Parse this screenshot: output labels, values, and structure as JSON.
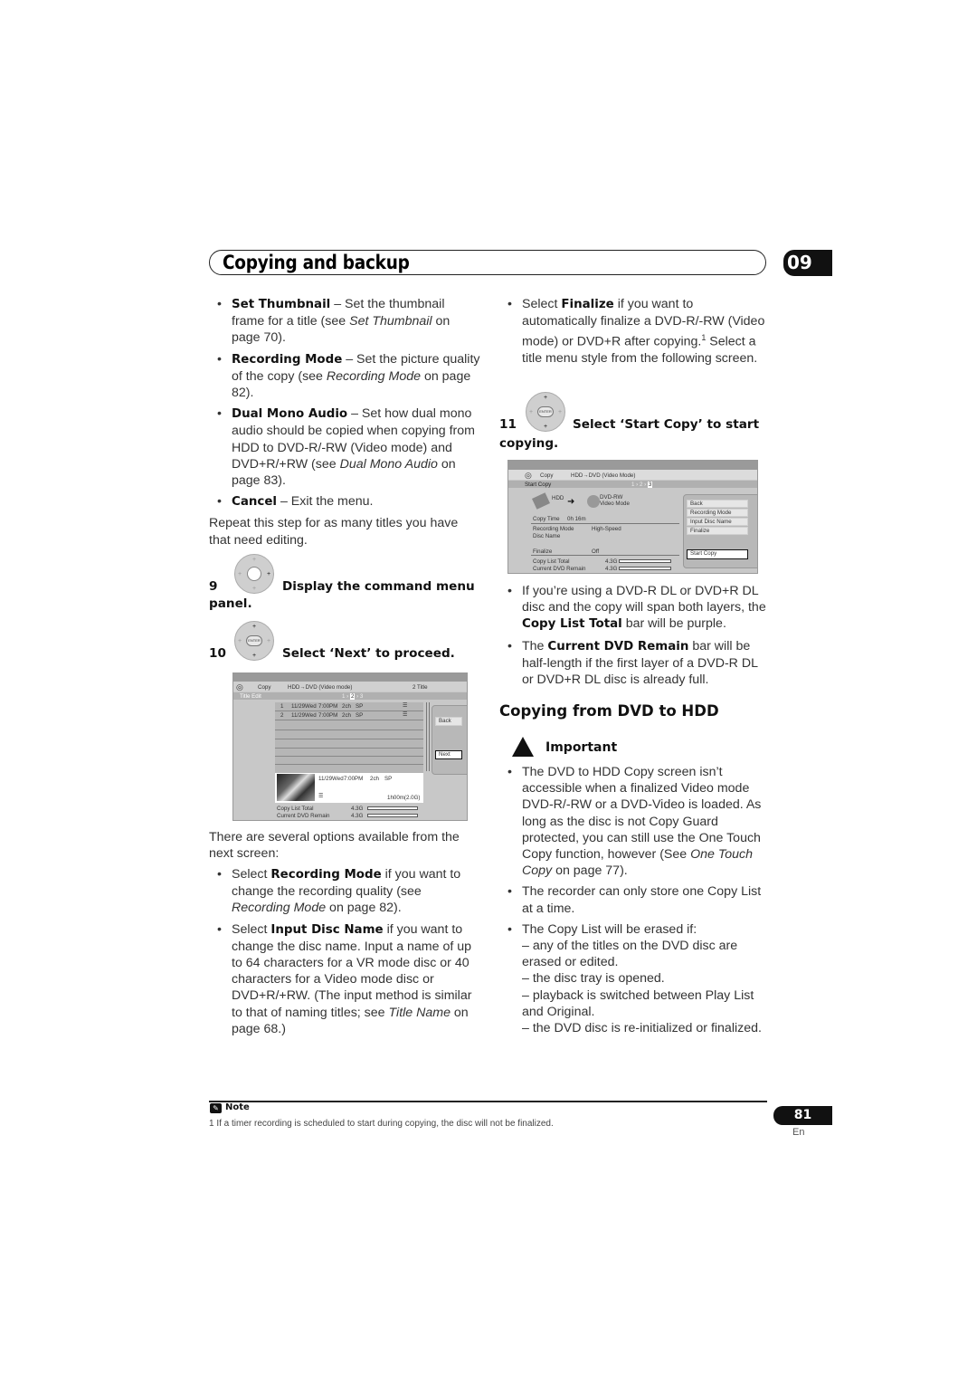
{
  "header": {
    "title": "Copying and backup",
    "chapter": "09"
  },
  "left": {
    "bullets1": [
      {
        "bold": "Set Thumbnail",
        "rest": " – Set the thumbnail frame for a title (see ",
        "ital": "Set Thumbnail",
        "end": " on page 70)."
      },
      {
        "bold": "Recording Mode",
        "rest": " – Set the picture quality of the copy (see ",
        "ital": "Recording Mode",
        "end": " on page 82)."
      },
      {
        "bold": "Dual Mono Audio",
        "rest": " – Set how dual mono audio should be copied when copying from HDD to DVD-R/-RW (Video mode) and DVD+R/+RW (see ",
        "ital": "Dual Mono Audio",
        "end": " on page 83)."
      },
      {
        "bold": "Cancel",
        "rest": " – Exit the menu.",
        "ital": "",
        "end": ""
      }
    ],
    "repeat_text": "Repeat this step for as many titles you have that need editing.",
    "step9": {
      "num": "9",
      "text": "Display the command menu",
      "cont": "panel."
    },
    "step10": {
      "num": "10",
      "text": "Select ‘Next’ to proceed."
    },
    "options_intro": "There are several options available from the next screen:",
    "bullets2": [
      {
        "pre": "Select ",
        "bold": "Recording Mode",
        "rest": " if you want to change the recording quality (see ",
        "ital": "Recording Mode",
        "end": " on page 82)."
      },
      {
        "pre": "Select ",
        "bold": "Input Disc Name",
        "rest": " if you want to change the disc name. Input a name of up to 64 characters for a VR mode disc or 40 characters for a Video mode disc or DVD+R/+RW. (The input method is similar to that of naming titles; see ",
        "ital": "Title Name",
        "end": " on page 68.)"
      }
    ]
  },
  "screen1": {
    "menu": "Copy",
    "mode": "HDD→DVD (Video mode)",
    "count": "2  Title",
    "section": "Title Edit",
    "steps": [
      "1",
      "2",
      "3"
    ],
    "rows": [
      {
        "num": "1",
        "date": "11/29Wed",
        "time": "7:00PM",
        "ch": "2ch",
        "rec": "SP"
      },
      {
        "num": "2",
        "date": "11/29Wed",
        "time": "7:00PM",
        "ch": "2ch",
        "rec": "SP"
      }
    ],
    "buttons": [
      "Back",
      "Next"
    ],
    "preview": {
      "date": "11/29Wed",
      "time": "7:00PM",
      "ch": "2ch",
      "rec": "SP",
      "duration": "1h00m(2.0G)"
    },
    "copy_list_total_label": "Copy List Total",
    "copy_list_total": "4.3G",
    "current_remain_label": "Current DVD Remain",
    "current_remain": "4.3G"
  },
  "right": {
    "finalize_bullet": {
      "pre": "Select ",
      "bold": "Finalize",
      "rest": " if you want to automatically finalize a DVD-R/-RW (Video mode) or DVD+R after copying.",
      "sup": "1",
      "end": " Select a title menu style from the following screen."
    },
    "step11": {
      "num": "11",
      "text": "Select ‘Start Copy’ to start",
      "cont": "copying."
    },
    "dl_bullets": [
      {
        "pre": "If you’re using a DVD-R DL or DVD+R DL disc and the copy will span both layers, the ",
        "bold": "Copy List Total",
        "end": " bar will be purple."
      },
      {
        "pre": "The ",
        "bold": "Current DVD Remain",
        "end": " bar will be half-length if the first layer of a DVD-R DL or DVD+R DL disc is already full."
      }
    ],
    "section_title": "Copying from DVD to HDD",
    "important_label": "Important",
    "important_bullets": [
      {
        "text": "The DVD to HDD Copy screen isn’t accessible when a finalized Video mode DVD-R/-RW or a DVD-Video is loaded. As long as the disc is not Copy Guard protected, you can still use the One Touch Copy function, however (See ",
        "ital": "One Touch Copy",
        "end": " on page 77)."
      },
      {
        "text": "The recorder can only store one Copy List at a time.",
        "ital": "",
        "end": ""
      }
    ],
    "erased_intro": "The Copy List will be erased if:",
    "erased_items": [
      "– any of the titles on the DVD disc are erased or edited.",
      "– the disc tray is opened.",
      "– playback is switched between Play List and Original.",
      "– the DVD disc is re-initialized or finalized."
    ]
  },
  "screen2": {
    "menu": "Copy",
    "mode": "HDD→DVD (Video Mode)",
    "section": "Start Copy",
    "steps": [
      "1",
      "2",
      "3"
    ],
    "source": "HDD",
    "dest": "DVD-RW",
    "dest_mode": "Video Mode",
    "copy_time_label": "Copy Time",
    "copy_time": "0h  16m",
    "rec_mode_label": "Recording Mode",
    "rec_mode": "High-Speed",
    "disc_name_label": "Disc Name",
    "finalize_label": "Finalize",
    "finalize": "Off",
    "copy_list_total_label": "Copy List Total",
    "copy_list_total": "4.3G",
    "current_remain_label": "Current DVD Remain",
    "current_remain": "4.3G",
    "buttons": [
      "Back",
      "Recording Mode",
      "Input Disc Name",
      "Finalize",
      "Start Copy"
    ]
  },
  "footer": {
    "note_label": "Note",
    "note_text": "1 If a timer recording is scheduled to start during copying, the disc will not be finalized.",
    "page": "81",
    "lang": "En"
  }
}
